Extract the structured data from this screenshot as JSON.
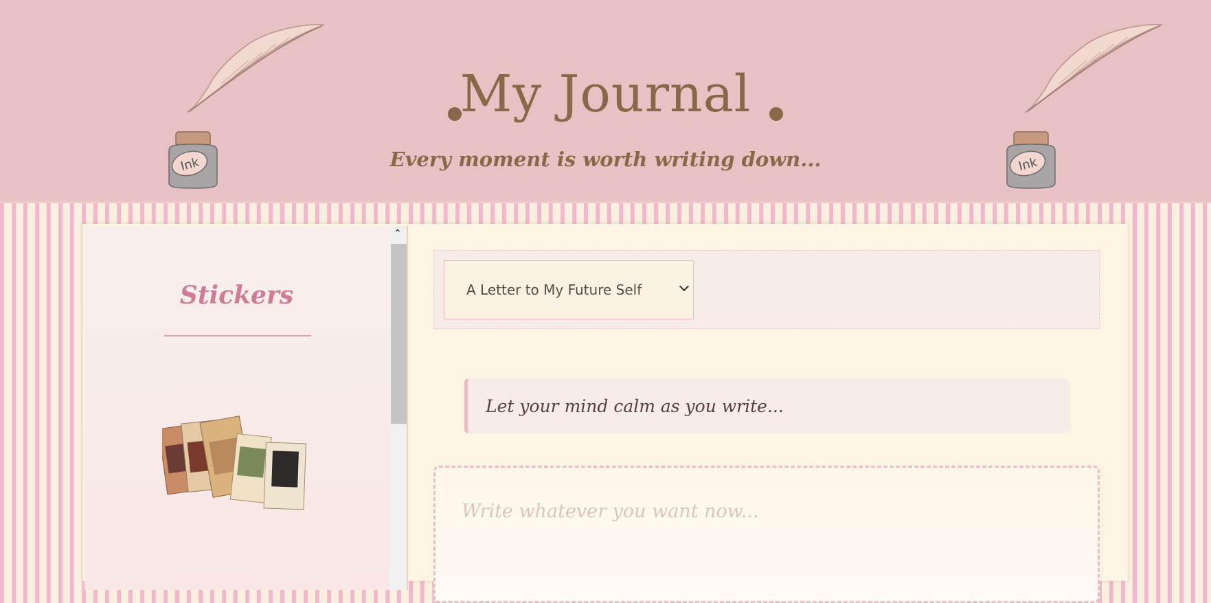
{
  "header": {
    "title": "My Journal",
    "subtitle": "Every moment is worth writing down...",
    "ink_label": "Ink"
  },
  "sidebar": {
    "title": "Stickers"
  },
  "editor": {
    "topic_selected": "A Letter to My Future Self",
    "prompt": "Let your mind calm as you write...",
    "writing_placeholder": "Write whatever you want now..."
  },
  "colors": {
    "header_bg": "#e7c1c3",
    "title": "#8a6748",
    "accent_pink": "#cf7c99",
    "paper": "#fdf5e4"
  },
  "icons": [
    "quill-icon",
    "ink-bottle-icon",
    "sticker-books",
    "chevron-up-icon",
    "chevron-down-icon"
  ]
}
